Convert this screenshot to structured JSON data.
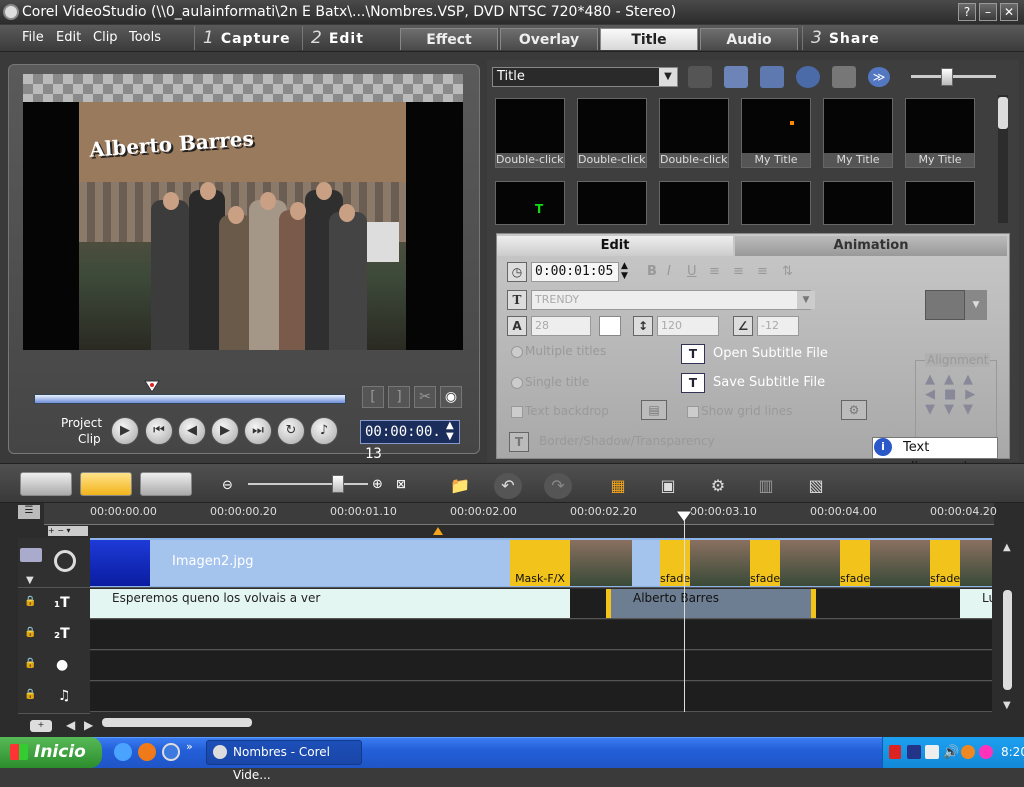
{
  "window": {
    "title": "Corel VideoStudio (\\\\0_aulainformati\\2n E Batx\\...\\Nombres.VSP, DVD NTSC 720*480 - Stereo)",
    "help": "?",
    "minimize": "–",
    "close": "✕"
  },
  "menu": [
    "File",
    "Edit",
    "Clip",
    "Tools"
  ],
  "steps": [
    {
      "num": "1",
      "label": "Capture"
    },
    {
      "num": "2",
      "label": "Edit"
    },
    {
      "num": "3",
      "label": "Share"
    }
  ],
  "subtabs": [
    "Effect",
    "Overlay",
    "Title",
    "Audio"
  ],
  "preview": {
    "overlay_title": "Alberto Barres",
    "project_label": "Project",
    "clip_label": "Clip",
    "timecode": "00:00:00. 13",
    "trim_in": "[",
    "trim_out": "]"
  },
  "library": {
    "dropdown": "Title",
    "row1": [
      "Double-click...",
      "Double-click...",
      "Double-click...",
      "My Title",
      "My Title",
      "My Title"
    ]
  },
  "titlepanel": {
    "tab_edit": "Edit",
    "tab_animation": "Animation",
    "duration": "0:00:01:05",
    "font": "TRENDY",
    "size": "28",
    "line_spacing": "120",
    "angle": "-12",
    "multiple_titles": "Multiple titles",
    "single_title": "Single title",
    "text_backdrop": "Text backdrop",
    "show_grid": "Show grid lines",
    "border_shadow": "Border/Shadow/Transparency",
    "open_subtitle": "Open Subtitle File",
    "save_subtitle": "Save Subtitle File",
    "alignment_label": "Alignment",
    "tooltip": "Text alignment"
  },
  "ruler": [
    "00:00:00.00",
    "00:00:00.20",
    "00:00:01.10",
    "00:00:02.00",
    "00:00:02.20",
    "00:00:03.10",
    "00:00:04.00",
    "00:00:04.20"
  ],
  "tracks": {
    "video_clip_name": "Imagen2.jpg",
    "mask_clip": "Mask-F/X",
    "title_clip1": "Esperemos queno los volvais a ver",
    "title_clip2": "Alberto Barres",
    "title_clip3": "Lu",
    "sfade": "sfade"
  },
  "taskbar": {
    "start": "Inicio",
    "task": "Nombres - Corel Vide...",
    "time": "8:20"
  },
  "colors": {
    "accent": "#f2c31a",
    "timecode_bg": "#1b2d5a",
    "xp_blue": "#235fd8"
  }
}
